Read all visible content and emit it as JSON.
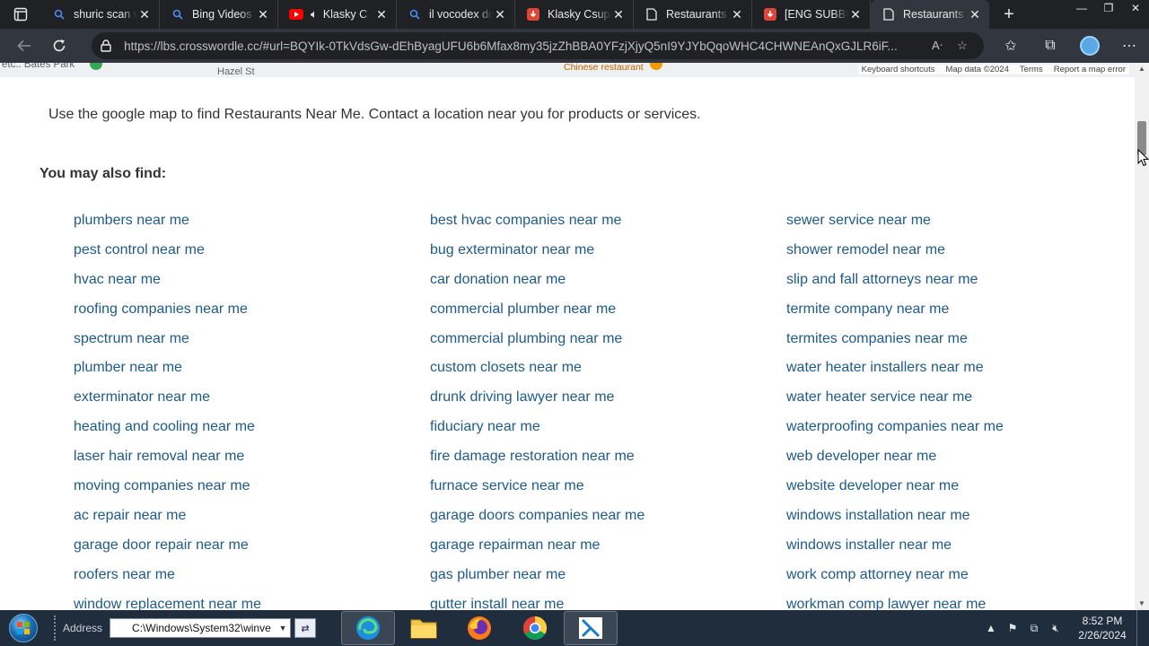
{
  "browser": {
    "tabs": [
      {
        "label": "shuric scan v",
        "icon": "search-icon"
      },
      {
        "label": "Bing Videos",
        "icon": "search-icon"
      },
      {
        "label": "Klasky C",
        "icon": "youtube-icon"
      },
      {
        "label": "il vocodex dc",
        "icon": "search-icon"
      },
      {
        "label": "Klasky Csupo",
        "icon": "download-icon"
      },
      {
        "label": "Restaurants",
        "icon": "page-icon"
      },
      {
        "label": "[ENG SUBBE",
        "icon": "download-icon"
      },
      {
        "label": "Restaurants",
        "icon": "page-icon",
        "active": true
      }
    ],
    "url": "https://lbs.crosswordle.cc/#url=BQYIk-0TkVdsGw-dEhByagUFU6b6Mfax8my35jzZhBBA0YFzjXjyQ5nI9YJYbQqoWHC4CHWNEAnQxGJLR6iF..."
  },
  "map": {
    "labels": [
      "etc.. Bates Park",
      "Hazel St",
      "Chinese restaurant"
    ],
    "footer": [
      "Keyboard shortcuts",
      "Map data ©2024",
      "Terms",
      "Report a map error"
    ]
  },
  "page": {
    "intro": "Use the google map to find Restaurants Near Me. Contact a location near you for products or services.",
    "also_find_heading": "You may also find:",
    "links_col1": [
      "plumbers near me",
      "pest control near me",
      "hvac near me",
      "roofing companies near me",
      "spectrum near me",
      "plumber near me",
      "exterminator near me",
      "heating and cooling near me",
      "laser hair removal near me",
      "moving companies near me",
      "ac repair near me",
      "garage door repair near me",
      "roofers near me",
      "window replacement near me"
    ],
    "links_col2": [
      "best hvac companies near me",
      "bug exterminator near me",
      "car donation near me",
      "commercial plumber near me",
      "commercial plumbing near me",
      "custom closets near me",
      "drunk driving lawyer near me",
      "fiduciary near me",
      "fire damage restoration near me",
      "furnace service near me",
      "garage doors companies near me",
      "garage repairman near me",
      "gas plumber near me",
      "gutter install near me"
    ],
    "links_col3": [
      "sewer service near me",
      "shower remodel near me",
      "slip and fall attorneys near me",
      "termite company near me",
      "termites companies near me",
      "water heater installers near me",
      "water heater service near me",
      "waterproofing companies near me",
      "web developer near me",
      "website developer near me",
      "windows installation near me",
      "windows installer near me",
      "work comp attorney near me",
      "workman comp lawyer near me"
    ]
  },
  "taskbar": {
    "address_label": "Address",
    "address_value": "C:\\Windows\\System32\\winve",
    "apps": [
      "edge-icon",
      "file-explorer-icon",
      "firefox-icon",
      "chrome-icon",
      "media-app-icon"
    ],
    "time": "8:52 PM",
    "date": "2/26/2024"
  },
  "colors": {
    "tabbar_bg": "#202124",
    "toolbar_bg": "#31363f",
    "link": "#1e5a8a",
    "taskbar_bg": "#1f2d3d"
  }
}
